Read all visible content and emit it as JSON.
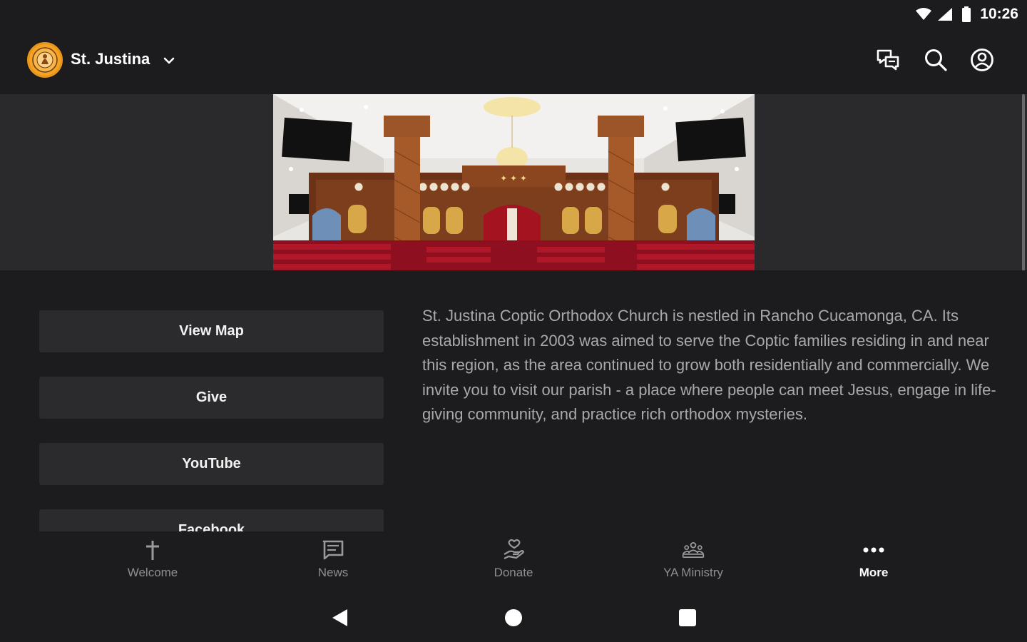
{
  "status_bar": {
    "time": "10:26",
    "icons": [
      "wifi-icon",
      "cell-signal-icon",
      "battery-icon"
    ]
  },
  "app_bar": {
    "parish_name": "St. Justina",
    "icons": [
      "chat-icon",
      "search-icon",
      "account-icon"
    ]
  },
  "links": [
    {
      "label": "View Map"
    },
    {
      "label": "Give"
    },
    {
      "label": "YouTube"
    },
    {
      "label": "Facebook"
    }
  ],
  "about": {
    "text": "St. Justina Coptic Orthodox Church is nestled in Rancho Cucamonga, CA. Its establishment in 2003 was aimed to serve the Coptic families residing in and near this region, as the area continued to grow both residentially and commercially. We invite you to visit our parish - a place where people can meet Jesus, engage in life-giving community, and practice rich orthodox mysteries."
  },
  "bottom_nav": {
    "items": [
      {
        "label": "Welcome",
        "icon": "cross-icon",
        "active": false
      },
      {
        "label": "News",
        "icon": "news-icon",
        "active": false
      },
      {
        "label": "Donate",
        "icon": "donate-icon",
        "active": false
      },
      {
        "label": "YA Ministry",
        "icon": "group-icon",
        "active": false
      },
      {
        "label": "More",
        "icon": "more-icon",
        "active": true
      }
    ]
  },
  "system_nav": [
    "back-icon",
    "home-icon",
    "recents-icon"
  ],
  "colors": {
    "background": "#1c1c1e",
    "button": "#2b2b2d",
    "accent": "#f4a324",
    "muted_text": "#a9a9ab"
  }
}
